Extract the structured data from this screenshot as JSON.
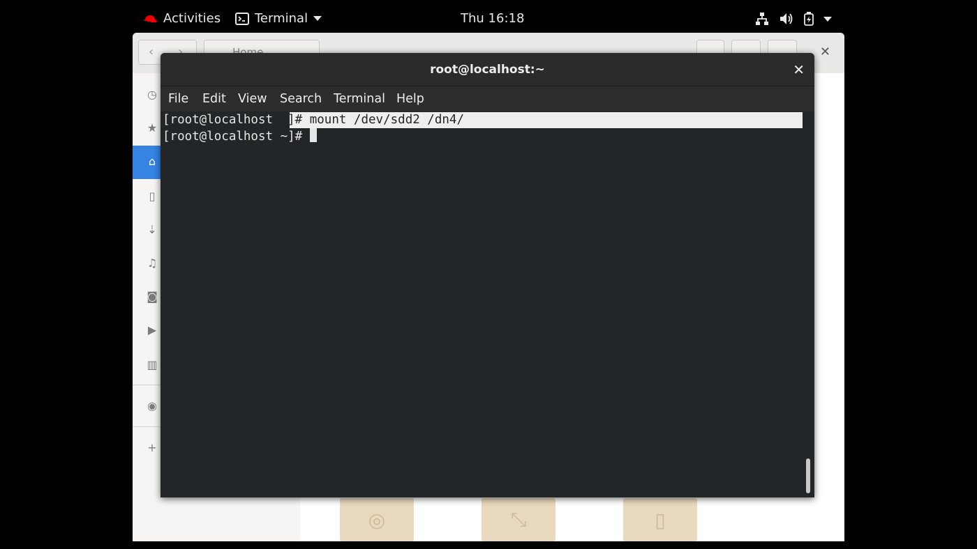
{
  "topbar": {
    "activities": "Activities",
    "app_name": "Terminal",
    "clock": "Thu 16:18",
    "icons": [
      "redhat-logo-icon",
      "terminal-app-icon",
      "network-icon",
      "volume-icon",
      "battery-icon",
      "system-menu-caret-icon"
    ]
  },
  "files_window": {
    "location": "Home",
    "sidebar_icons": [
      "recent-icon",
      "starred-icon",
      "home-icon",
      "documents-icon",
      "downloads-icon",
      "music-icon",
      "pictures-icon",
      "videos-icon",
      "trash-icon",
      "disc-icon",
      "add-location-icon"
    ]
  },
  "terminal": {
    "title": "root@localhost:~",
    "menu": [
      "File",
      "Edit",
      "View",
      "Search",
      "Terminal",
      "Help"
    ],
    "lines": [
      {
        "prompt": "[root@localhost ",
        "selected": "~]# mount /dev/sdd2 /dn4/"
      },
      {
        "prompt": "[root@localhost ~]# ",
        "selected": ""
      }
    ]
  },
  "colors": {
    "accent": "#3584e4",
    "terminal_bg": "#232629",
    "titlebar": "#2b2b2b",
    "folder": "#e9d9be"
  }
}
